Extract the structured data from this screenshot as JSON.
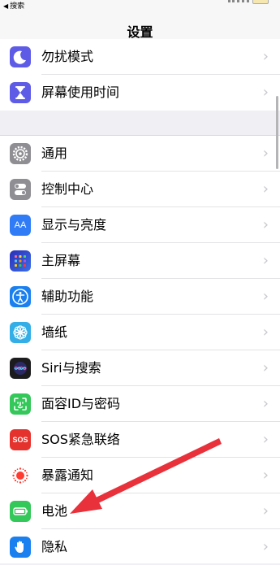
{
  "status_bar": {
    "back_arrow": "◀",
    "back_label": "搜索"
  },
  "nav": {
    "title": "设置"
  },
  "group1": [
    {
      "label": "勿扰模式",
      "icon": "moon-icon",
      "color": "#5e5ce6"
    },
    {
      "label": "屏幕使用时间",
      "icon": "hourglass-icon",
      "color": "#5e5ce6"
    }
  ],
  "group2": [
    {
      "label": "通用",
      "icon": "gear-icon",
      "color": "#8e8e93"
    },
    {
      "label": "控制中心",
      "icon": "toggles-icon",
      "color": "#8e8e93"
    },
    {
      "label": "显示与亮度",
      "icon": "text-size-icon",
      "color": "#2f7cf6",
      "glyph": "AA"
    },
    {
      "label": "主屏幕",
      "icon": "home-grid-icon",
      "color": "#2f4fd6"
    },
    {
      "label": "辅助功能",
      "icon": "accessibility-icon",
      "color": "#1a80f0"
    },
    {
      "label": "墙纸",
      "icon": "flower-icon",
      "color": "#33aee6"
    },
    {
      "label": "Siri与搜索",
      "icon": "siri-icon",
      "color": "#1c1c1e"
    },
    {
      "label": "面容ID与密码",
      "icon": "face-id-icon",
      "color": "#34c759"
    },
    {
      "label": "SOS紧急联络",
      "icon": "sos-icon",
      "color": "#e5322d",
      "glyph": "SOS"
    },
    {
      "label": "暴露通知",
      "icon": "exposure-icon",
      "color": "#ffffff"
    },
    {
      "label": "电池",
      "icon": "battery-icon",
      "color": "#34c759"
    },
    {
      "label": "隐私",
      "icon": "hand-icon",
      "color": "#1a80f0"
    }
  ],
  "chevron": "›",
  "annotation": {
    "color": "#e8313a"
  }
}
